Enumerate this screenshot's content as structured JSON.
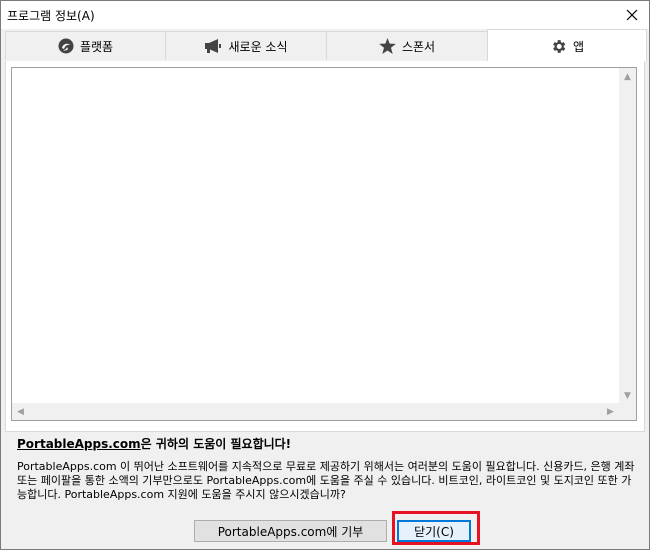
{
  "window": {
    "title": "프로그램 정보(A)"
  },
  "tabs": [
    {
      "label": "플랫폼",
      "icon": "portableapps-logo-icon",
      "active": false
    },
    {
      "label": "새로운 소식",
      "icon": "megaphone-icon",
      "active": false
    },
    {
      "label": "스폰서",
      "icon": "star-icon",
      "active": false
    },
    {
      "label": "앱",
      "icon": "gear-icon",
      "active": true
    }
  ],
  "donate": {
    "heading_link": "PortableApps.com",
    "heading_rest": "은 귀하의 도움이 필요합니다!",
    "body": "PortableApps.com 이 뛰어난 소프트웨어를 지속적으로 무료로 제공하기 위해서는 여러분의 도움이 필요합니다. 신용카드, 은행 계좌 또는 페이팔을 통한 소액의 기부만으로도 PortableApps.com에 도움을 주실 수 있습니다. 비트코인, 라이트코인 및 도지코인 또한 가능합니다. PortableApps.com 지원에 도움을 주시지 않으시겠습니까?"
  },
  "buttons": {
    "donate_label": "PortableApps.com에 기부",
    "close_label": "닫기(C)"
  },
  "colors": {
    "accent": "#0078d7",
    "highlight": "#e81123",
    "icon": "#444444"
  }
}
